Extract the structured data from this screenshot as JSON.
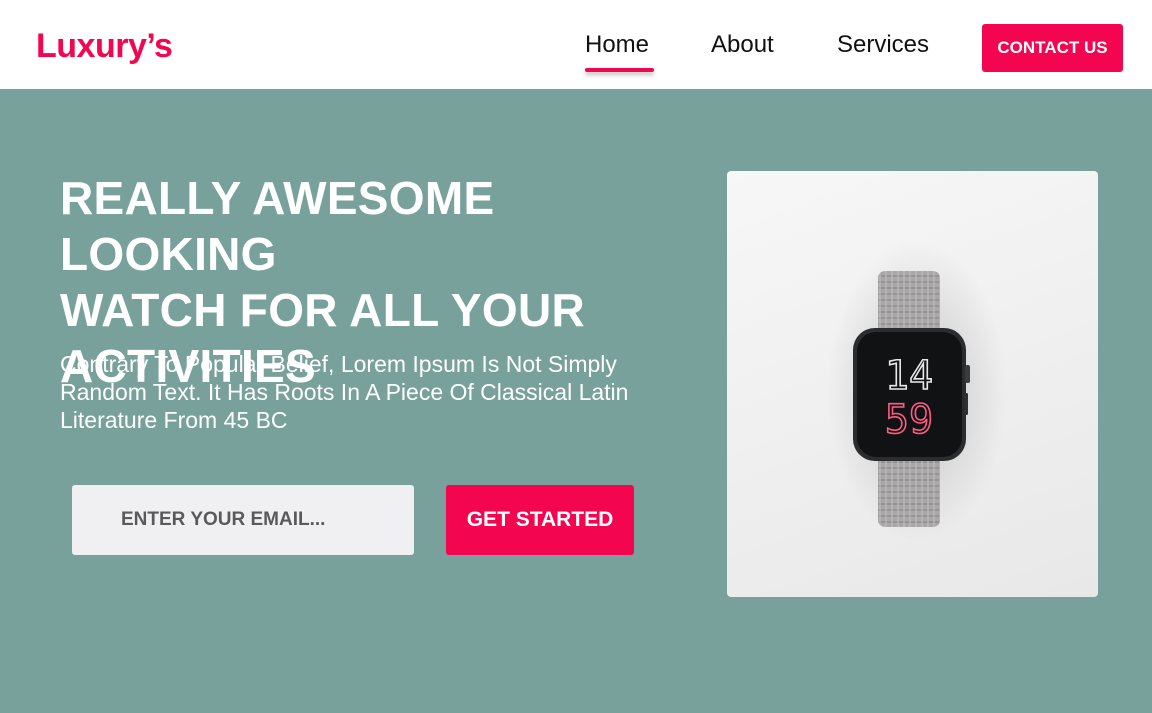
{
  "brand": {
    "logo_text": "Luxury’s",
    "accent_color": "#f3064f"
  },
  "nav": {
    "items": [
      {
        "label": "Home",
        "active": true
      },
      {
        "label": "About",
        "active": false
      },
      {
        "label": "Services",
        "active": false
      }
    ],
    "contact_label": "CONTACT US"
  },
  "hero": {
    "title_lines": [
      "REALLY AWESOME LOOKING",
      "WATCH FOR ALL YOUR",
      "ACTIVITIES"
    ],
    "subtitle_lines": [
      "Contrary To Popular Belief, Lorem Ipsum Is Not Simply",
      "Random Text. It Has Roots In A Piece Of Classical Latin",
      "Literature From 45 BC"
    ],
    "email_placeholder": "ENTER YOUR EMAIL...",
    "cta_label": "GET STARTED",
    "background_color": "#79a19c"
  },
  "product_image": {
    "watch_time_hour": "14",
    "watch_time_minute": "59"
  }
}
